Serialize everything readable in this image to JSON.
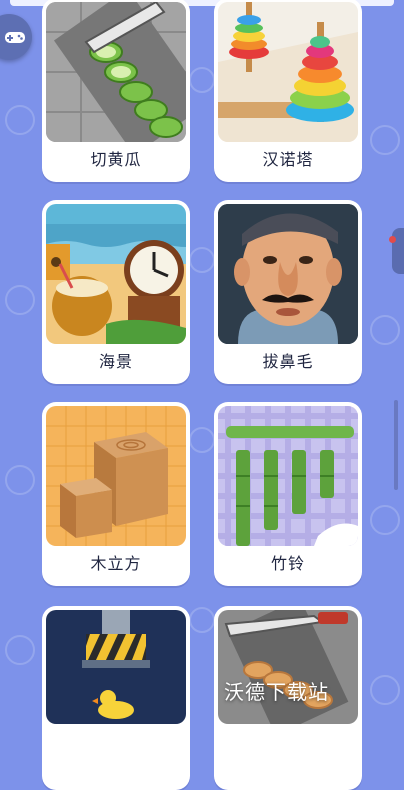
{
  "games": [
    {
      "label": "切黄瓜"
    },
    {
      "label": "汉诺塔"
    },
    {
      "label": "海景"
    },
    {
      "label": "拔鼻毛"
    },
    {
      "label": "木立方"
    },
    {
      "label": "竹铃"
    },
    {
      "label": ""
    },
    {
      "label": ""
    }
  ],
  "icons": {
    "float_button": "gamepad-icon"
  },
  "colors": {
    "background": "#7d92ea",
    "card": "#ffffff",
    "label_text": "#1f2540"
  },
  "watermark": "沃德下载站"
}
